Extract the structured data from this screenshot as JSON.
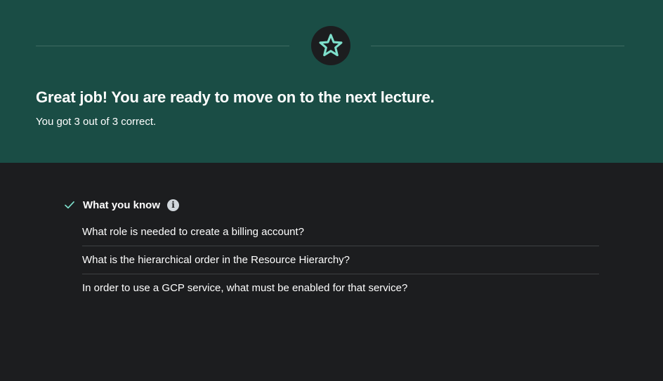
{
  "result": {
    "badge_icon": "star-icon",
    "title": "Great job! You are ready to move on to the next lecture.",
    "subtitle": "You got 3 out of 3 correct.",
    "correct_count": 3,
    "total_count": 3
  },
  "what_you_know": {
    "status_icon": "check-icon",
    "title": "What you know",
    "info_icon": "info-icon",
    "questions": [
      "What role is needed to create a billing account?",
      "What is the hierarchical order in the Resource Hierarchy?",
      "In order to use a GCP service, what must be enabled for that service?"
    ]
  },
  "colors": {
    "hero_background": "#1a4d45",
    "page_background": "#1c1d1f",
    "accent_mint": "#7ee0cc",
    "text": "#ffffff"
  }
}
